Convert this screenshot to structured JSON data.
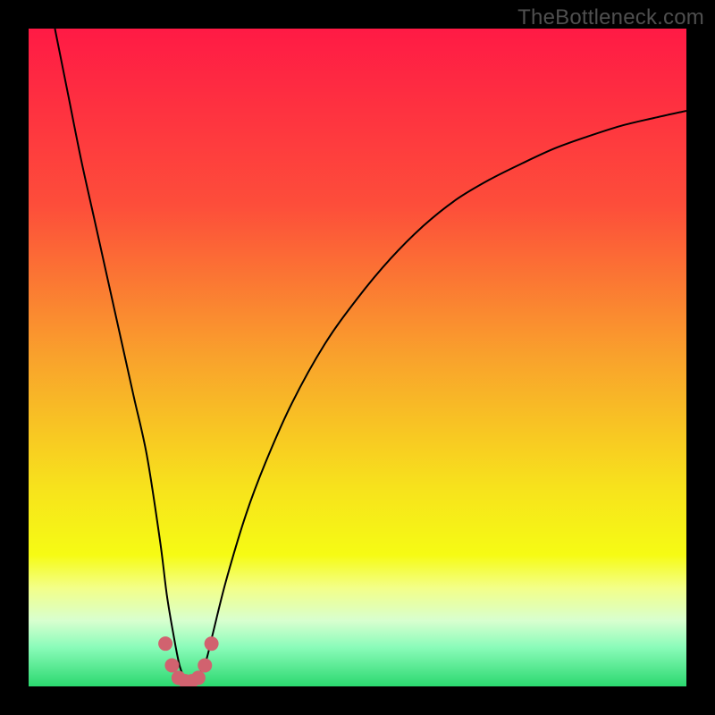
{
  "watermark": "TheBottleneck.com",
  "chart_data": {
    "type": "line",
    "title": "",
    "xlabel": "",
    "ylabel": "",
    "xlim": [
      0,
      100
    ],
    "ylim": [
      0,
      100
    ],
    "grid": false,
    "legend": false,
    "background_gradient": {
      "stops": [
        {
          "offset": 0.0,
          "color": "#ff1a45"
        },
        {
          "offset": 0.27,
          "color": "#fd4e3a"
        },
        {
          "offset": 0.5,
          "color": "#f9a22c"
        },
        {
          "offset": 0.7,
          "color": "#f7e31c"
        },
        {
          "offset": 0.8,
          "color": "#f6fb14"
        },
        {
          "offset": 0.85,
          "color": "#f3ff88"
        },
        {
          "offset": 0.9,
          "color": "#d8ffcf"
        },
        {
          "offset": 0.94,
          "color": "#8bfcba"
        },
        {
          "offset": 1.0,
          "color": "#2bd86f"
        }
      ]
    },
    "series": [
      {
        "name": "bottleneck-curve",
        "x": [
          4,
          6,
          8,
          10,
          12,
          14,
          16,
          18,
          20,
          21,
          22,
          23,
          24,
          25,
          26,
          27,
          28,
          30,
          33,
          36,
          40,
          45,
          50,
          55,
          60,
          65,
          70,
          75,
          80,
          85,
          90,
          95,
          100
        ],
        "y": [
          100,
          90,
          80,
          71,
          62,
          53,
          44,
          35,
          22,
          14,
          8,
          3,
          1,
          1,
          2,
          4,
          8,
          16,
          26,
          34,
          43,
          52,
          59,
          65,
          70,
          74,
          77,
          79.5,
          81.8,
          83.6,
          85.2,
          86.4,
          87.5
        ],
        "color": "#000000",
        "width": 2
      }
    ],
    "marker_cluster": {
      "color": "#d1626f",
      "radius": 8,
      "points_xy": [
        [
          20.8,
          6.5
        ],
        [
          21.8,
          3.2
        ],
        [
          22.8,
          1.3
        ],
        [
          23.8,
          0.8
        ],
        [
          24.8,
          0.8
        ],
        [
          25.8,
          1.3
        ],
        [
          26.8,
          3.2
        ],
        [
          27.8,
          6.5
        ]
      ]
    }
  }
}
